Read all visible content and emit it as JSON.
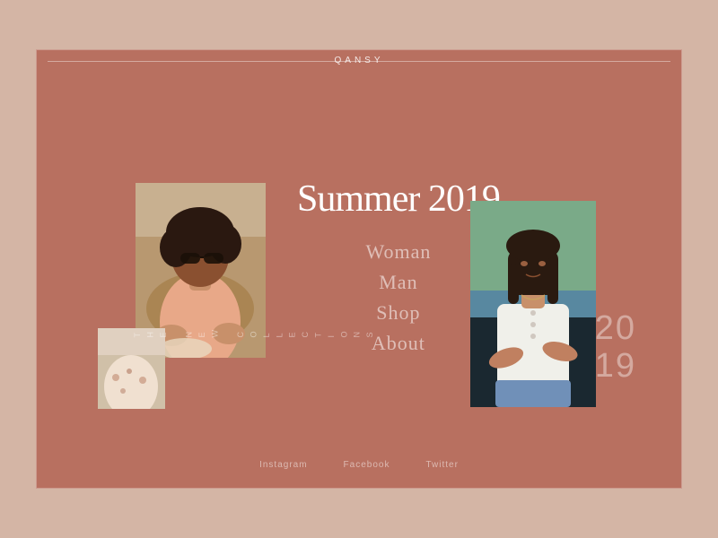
{
  "brand": "QANSY",
  "headline": {
    "prefix": "Summer 20",
    "suffix": "19"
  },
  "nav": {
    "items": [
      {
        "label": "Woman",
        "id": "woman"
      },
      {
        "label": "Man",
        "id": "man"
      },
      {
        "label": "Shop",
        "id": "shop"
      },
      {
        "label": "About",
        "id": "about"
      }
    ]
  },
  "vertical_text": "THE NEW COLLECTIONS",
  "year_large": "20\n19",
  "social": [
    {
      "label": "Instagram",
      "id": "instagram"
    },
    {
      "label": "Facebook",
      "id": "facebook"
    },
    {
      "label": "Twitter",
      "id": "twitter"
    }
  ],
  "colors": {
    "bg_outer": "#d4b5a5",
    "bg_card": "#b87060",
    "text_white": "#ffffff",
    "text_muted": "rgba(255,255,255,0.5)"
  }
}
